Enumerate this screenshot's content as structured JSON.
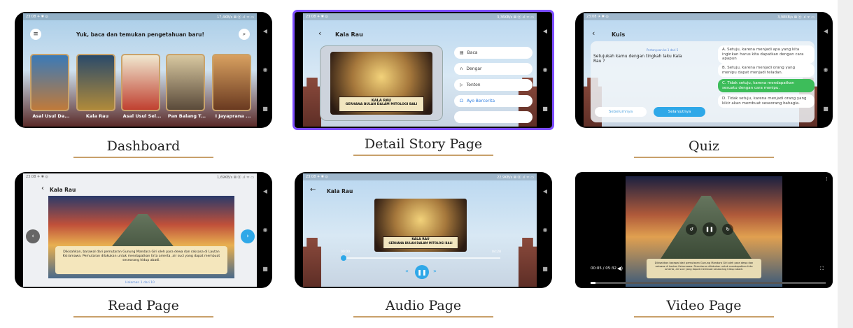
{
  "screens": {
    "dashboard": {
      "caption": "Dashboard",
      "status_time": "23:08 ✈ ✱ ◎",
      "status_right": "17,4KB/s ⊠ ⦿ .ıl ᯤ ▭",
      "header_title": "Yuk, baca dan temukan pengetahuan baru!",
      "books": [
        "Asal Usul Da...",
        "Kala Rau",
        "Asal Usul Sel...",
        "Pan Balang T...",
        "I Jayaprana ..."
      ]
    },
    "detail": {
      "caption": "Detail Story Page",
      "status_time": "23:08 ✈ ✱ ◎",
      "status_right": "3,36KB/s ⊠ ⦿ .ıl ᯤ ▭",
      "title": "Kala Rau",
      "img_caption_1": "KALA RAU",
      "img_caption_2": "GERHANA BULAN DALAM MITOLOGI BALI",
      "menu": [
        "Baca",
        "Dengar",
        "Tonton",
        "Ayo Bercerita"
      ]
    },
    "quiz": {
      "caption": "Quiz",
      "status_time": "23:08 ✈ ✱ ◎",
      "status_right": "3,98KB/s ⊠ ⦿ .ıl ᯤ ▭",
      "title": "Kuis",
      "progress_label": "Pertanyaan ke 1 dari 5",
      "question": "Setujukah kamu dengan tingkah laku Kala Rau ?",
      "options": [
        "A. Setuju, karena menjadi apa yang kita inginkan harus kita dapatkan dengan cara apapun",
        "B. Setuju, karena menjadi orang yang menipu dapat menjadi teladan.",
        "C. Tidak setuju, karena mendapatkan sesuatu dengan cara menipu.",
        "D. Tidak setuju, karena menjadi orang yang kikir akan membuat seseorang bahagia."
      ],
      "prev_label": "Sebelumnya",
      "next_label": "Selanjutnya"
    },
    "read": {
      "caption": "Read Page",
      "status_time": "23:08 ✈ ✱ ◎",
      "status_right": "1,69KB/s ⊠ ⦿ .ıl ᯤ ▭",
      "title": "Kala Rau",
      "text": "Dikisahkan, barawal dari pemutaran Gunung Mandara Giri oleh para dewa dan raksasa di Lautan Ksiramawa. Pemutaran dilakukan untuk mendapatkan tirta amerta, air suci yang dapat membuat seseorang hidup abadi.",
      "page_label": "Halaman 1 dari 10"
    },
    "audio": {
      "caption": "Audio Page",
      "status_time": "23:08 ✈ ✱ ◎",
      "status_right": "22,9KB/s ⊠ ⦿ .ıl ᯤ ▭",
      "title": "Kala Rau",
      "img_caption_1": "KALA RAU",
      "img_caption_2": "GERHANA BULAN DALAM MITOLOGI BALI",
      "time_current": "00:00",
      "time_total": "04:28",
      "progress": 0.01
    },
    "video": {
      "caption": "Video Page",
      "time_label": "00:05 / 05:32",
      "subtitle": "Dikisahkan barawal dari pemutaran Gunung Mandara Giri oleh para dewa dan raksasa di Lautan Ksiramawa. Pemutaran dilakukan untuk mendapatkan tirta amerta, air suci yang dapat membuat seseorang hidup abadi.",
      "progress": 0.02
    }
  }
}
